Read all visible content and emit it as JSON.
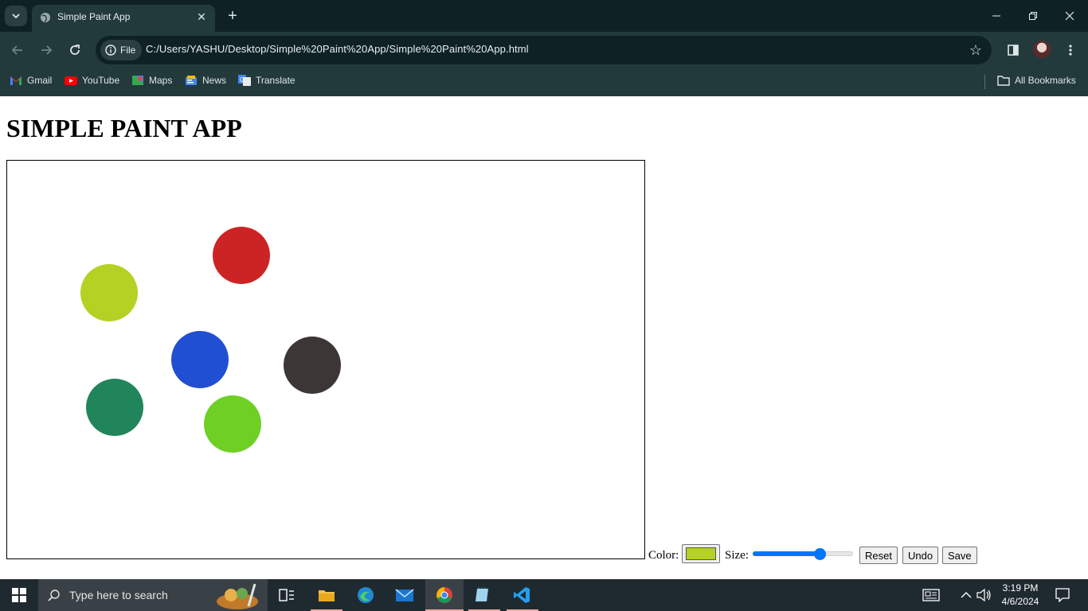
{
  "browser": {
    "tab_title": "Simple Paint App",
    "file_chip": "File",
    "url": "C:/Users/YASHU/Desktop/Simple%20Paint%20App/Simple%20Paint%20App.html",
    "bookmarks": [
      "Gmail",
      "YouTube",
      "Maps",
      "News",
      "Translate"
    ],
    "all_bookmarks": "All Bookmarks"
  },
  "page": {
    "heading": "SIMPLE PAINT APP",
    "controls": {
      "color_label": "Color:",
      "selected_color": "#b5d124",
      "size_label": "Size:",
      "size_fraction": 0.69,
      "reset_label": "Reset",
      "undo_label": "Undo",
      "save_label": "Save"
    },
    "canvas_dots": [
      {
        "color": "#cc2424"
      },
      {
        "color": "#b5d124"
      },
      {
        "color": "#214fd1"
      },
      {
        "color": "#3d3636"
      },
      {
        "color": "#21855b"
      },
      {
        "color": "#6ed024"
      }
    ]
  },
  "taskbar": {
    "search_placeholder": "Type here to search",
    "time": "3:19 PM",
    "date": "4/6/2024"
  }
}
